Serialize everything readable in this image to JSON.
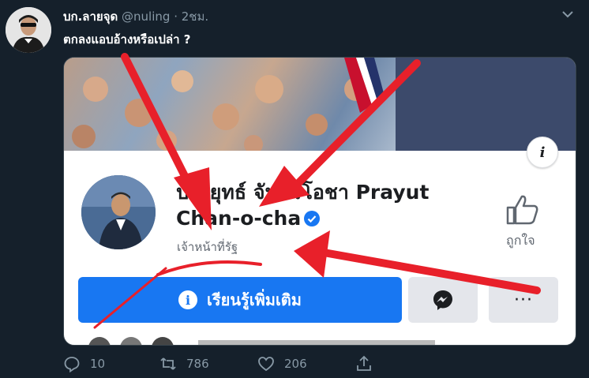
{
  "tweet": {
    "display_name": "บก.ลายจุด",
    "handle": "@nuling",
    "separator": "·",
    "time": "2ชม.",
    "text": "ตกลงแอบอ้างหรือเปล่า ?",
    "icons": {
      "more": "chevron-down-icon",
      "avatar": "user-avatar"
    }
  },
  "card": {
    "info_icon_label": "i",
    "page_name": "ประยุทธ์ จันทร์โอชา Prayut Chan-o-cha",
    "category": "เจ้าหน้าที่รัฐ",
    "like_label": "ถูกใจ",
    "learn_more_label": "เรียนรู้เพิ่มเติม",
    "more_label": "···",
    "icons": {
      "verified": "verified-badge-icon",
      "like": "thumbs-up-icon",
      "messenger": "messenger-icon",
      "info": "info-icon"
    },
    "colors": {
      "primary_button": "#1877f2",
      "verified": "#1877f2",
      "secondary_button": "#e4e6eb"
    }
  },
  "actions": {
    "replies": "10",
    "retweets": "786",
    "likes": "206",
    "icons": [
      "reply-icon",
      "retweet-icon",
      "like-icon",
      "share-icon"
    ]
  },
  "theme": {
    "background": "#15202b",
    "text": "#ffffff",
    "muted": "#8899a6",
    "annotation": "#e8202a"
  }
}
